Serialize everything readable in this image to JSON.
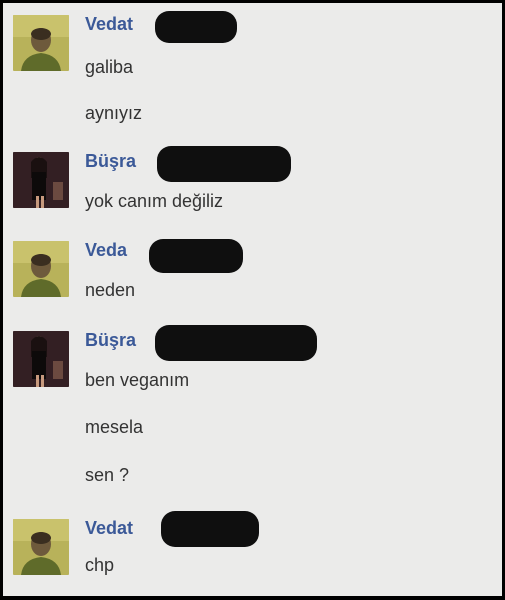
{
  "colors": {
    "background": "#ebebea",
    "sender_name": "#3b5998",
    "message_text": "#333333",
    "redaction": "#0f0f0f"
  },
  "conversation": [
    {
      "sender": "Vedat",
      "avatar": "vedat-avatar",
      "messages": [
        "galiba",
        "aynıyız"
      ]
    },
    {
      "sender": "Büşra",
      "avatar": "busra-avatar",
      "messages": [
        "yok canım değiliz"
      ]
    },
    {
      "sender": "Veda",
      "avatar": "vedat-avatar",
      "messages": [
        "neden"
      ]
    },
    {
      "sender": "Büşra",
      "avatar": "busra-avatar",
      "messages": [
        "ben veganım",
        "mesela",
        "sen ?"
      ]
    },
    {
      "sender": "Vedat",
      "avatar": "vedat-avatar",
      "messages": [
        "chp"
      ]
    }
  ]
}
